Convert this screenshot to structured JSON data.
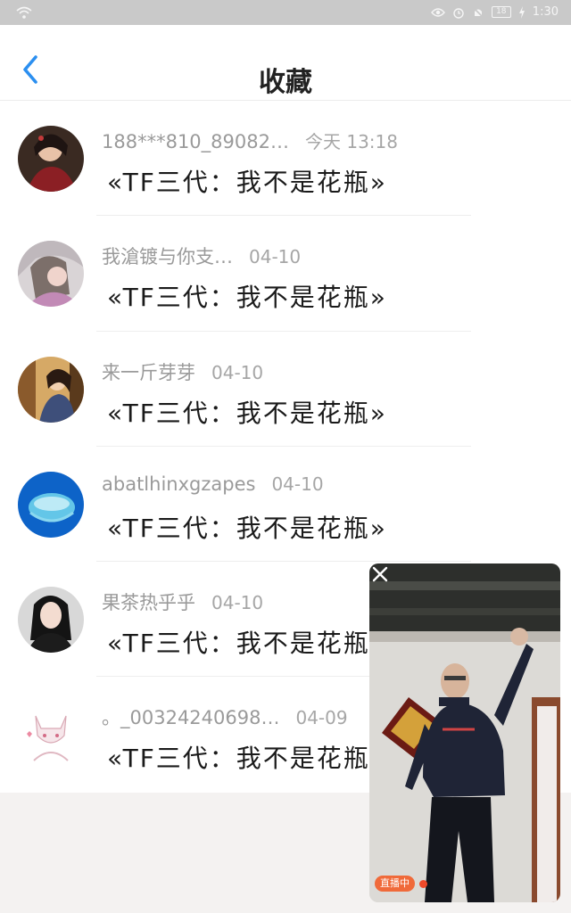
{
  "status_bar": {
    "time": "1:30",
    "battery": "18",
    "icons": [
      "wifi-icon",
      "eye-icon",
      "alarm-icon",
      "mute-icon",
      "battery-icon",
      "charging-icon"
    ]
  },
  "header": {
    "title": "收藏",
    "back_icon": "chevron-left-icon"
  },
  "items": [
    {
      "name": "188***810_89082…",
      "date": "今天 13:18",
      "text": "«TF三代：我不是花瓶»"
    },
    {
      "name": "我滄镀与你支…",
      "date": "04-10",
      "text": "«TF三代：我不是花瓶»"
    },
    {
      "name": "来一斤芽芽",
      "date": "04-10",
      "text": "«TF三代：我不是花瓶»"
    },
    {
      "name": "abatlhinxgzapes",
      "date": "04-10",
      "text": "«TF三代：我不是花瓶»"
    },
    {
      "name": "果茶热乎乎",
      "date": "04-10",
      "text": "«TF三代：我不是花瓶"
    },
    {
      "name": "。_00324240698…",
      "date": "04-09",
      "text": "«TF三代：我不是花瓶"
    }
  ],
  "video": {
    "live_label": "直播中",
    "close_icon": "close-icon"
  },
  "colors": {
    "accent": "#2b8ff0",
    "live": "#f06a3a"
  }
}
